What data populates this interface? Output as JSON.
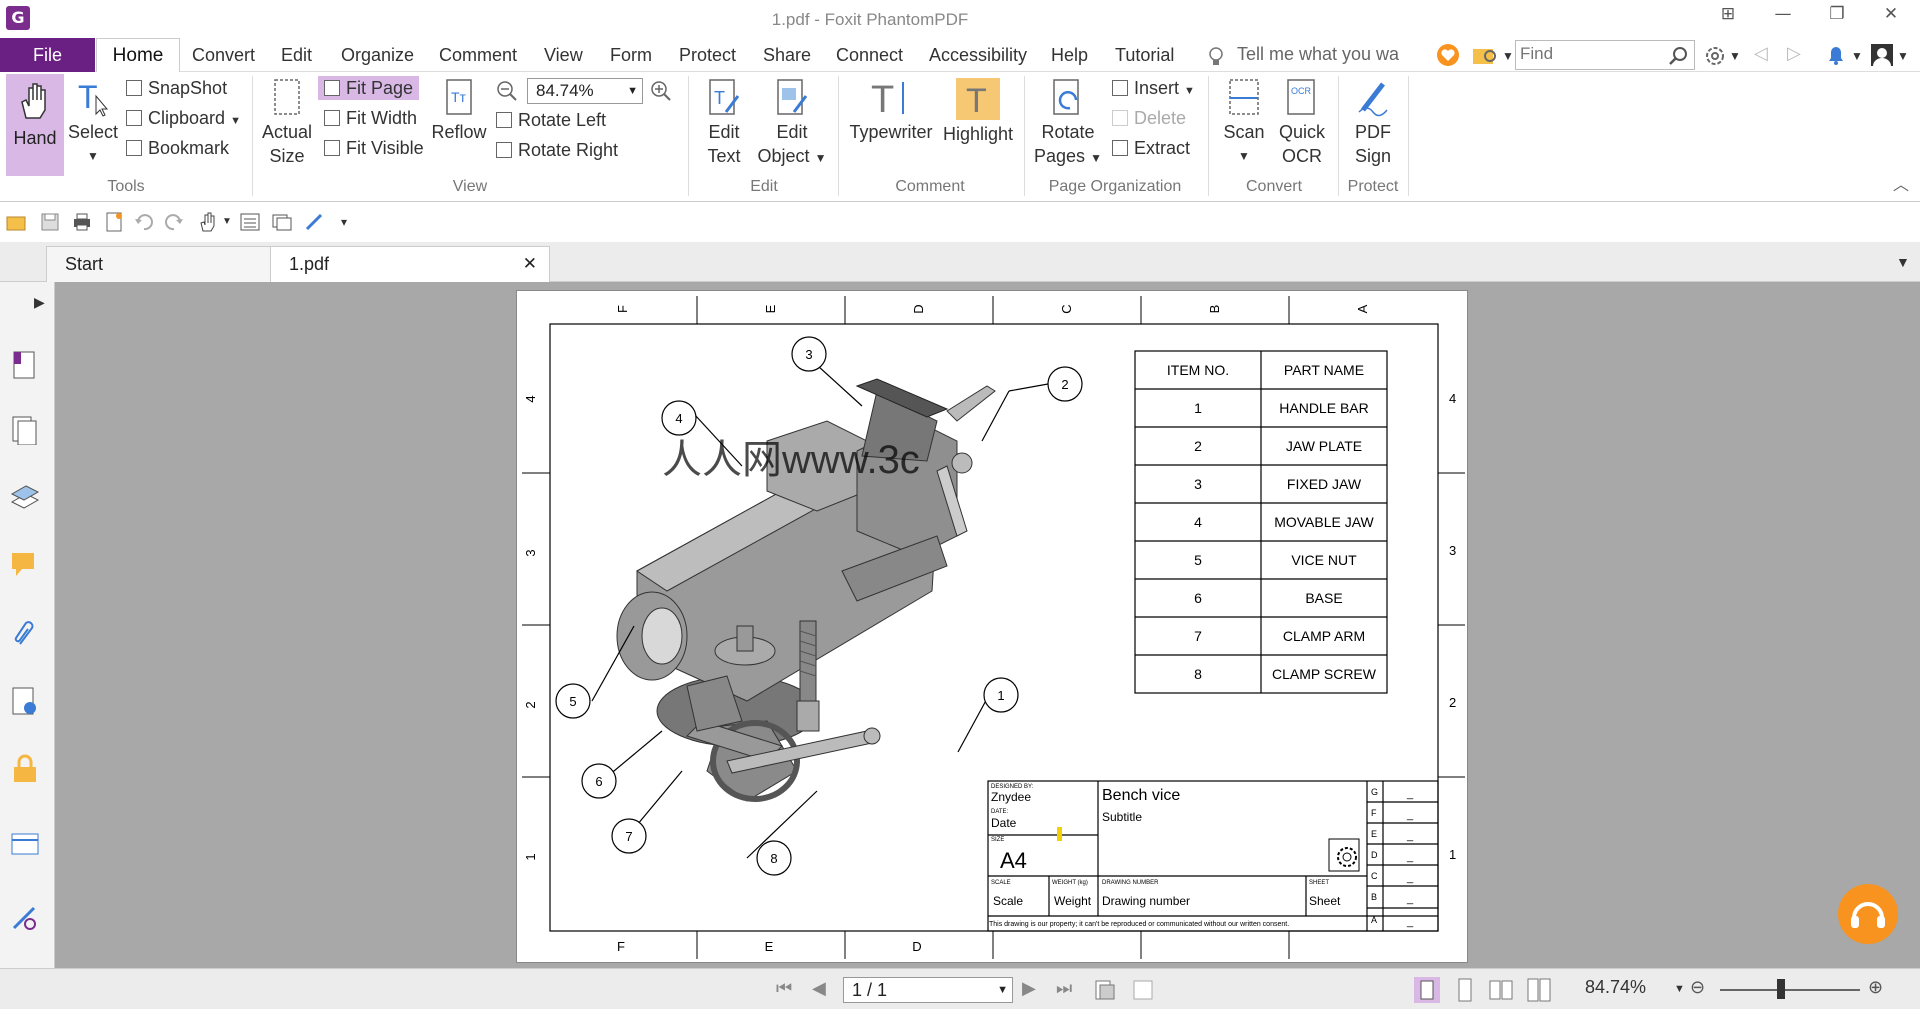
{
  "window": {
    "title": "1.pdf - Foxit PhantomPDF",
    "logo": "G"
  },
  "menu": {
    "file": "File",
    "items": [
      "Home",
      "Convert",
      "Edit",
      "Organize",
      "Comment",
      "View",
      "Form",
      "Protect",
      "Share",
      "Connect",
      "Accessibility",
      "Help",
      "Tutorial"
    ],
    "tell_me": "Tell me what you wa",
    "find_placeholder": "Find"
  },
  "ribbon": {
    "tools": {
      "label": "Tools",
      "hand": "Hand",
      "select": "Select",
      "snapshot": "SnapShot",
      "clipboard": "Clipboard",
      "bookmark": "Bookmark"
    },
    "view": {
      "label": "View",
      "actual1": "Actual",
      "actual2": "Size",
      "fit_page": "Fit Page",
      "fit_width": "Fit Width",
      "fit_visible": "Fit Visible",
      "reflow": "Reflow",
      "zoom": "84.74%",
      "rotate_left": "Rotate Left",
      "rotate_right": "Rotate Right"
    },
    "edit": {
      "label": "Edit",
      "edit_text1": "Edit",
      "edit_text2": "Text",
      "edit_object1": "Edit",
      "edit_object2": "Object"
    },
    "comment": {
      "label": "Comment",
      "typewriter": "Typewriter",
      "highlight": "Highlight"
    },
    "page_org": {
      "label": "Page Organization",
      "rotate1": "Rotate",
      "rotate2": "Pages",
      "insert": "Insert",
      "delete": "Delete",
      "extract": "Extract"
    },
    "convert": {
      "label": "Convert",
      "scan": "Scan",
      "quick1": "Quick",
      "quick2": "OCR",
      "ocr_badge": "OCR"
    },
    "protect": {
      "label": "Protect",
      "sign1": "PDF",
      "sign2": "Sign"
    }
  },
  "tabs": {
    "start": "Start",
    "doc": "1.pdf",
    "close": "✕"
  },
  "drawing": {
    "col_labels": [
      "F",
      "E",
      "D",
      "C",
      "B",
      "A"
    ],
    "row_labels": [
      "4",
      "3",
      "2",
      "1"
    ],
    "bom_headers": [
      "ITEM NO.",
      "PART NAME"
    ],
    "bom_rows": [
      [
        "1",
        "HANDLE BAR"
      ],
      [
        "2",
        "JAW PLATE"
      ],
      [
        "3",
        "FIXED JAW"
      ],
      [
        "4",
        "MOVABLE JAW"
      ],
      [
        "5",
        "VICE NUT"
      ],
      [
        "6",
        "BASE"
      ],
      [
        "7",
        "CLAMP ARM"
      ],
      [
        "8",
        "CLAMP SCREW"
      ]
    ],
    "balloons": [
      "1",
      "2",
      "3",
      "4",
      "5",
      "6",
      "7",
      "8"
    ],
    "watermark": "人人网www.3c",
    "title_block": {
      "designed_by_label": "DESIGNED BY:",
      "designed_by": "Znydee",
      "date_label": "DATE:",
      "date": "Date",
      "size_label": "SIZE",
      "size": "A4",
      "title": "Bench vice",
      "subtitle": "Subtitle",
      "scale_label": "SCALE",
      "scale": "Scale",
      "weight_label": "WEIGHT (kg)",
      "weight": "Weight",
      "drawing_number_label": "DRAWING NUMBER",
      "drawing_number": "Drawing number",
      "sheet_label": "SHEET",
      "sheet": "Sheet",
      "rev_letters": [
        "G",
        "F",
        "E",
        "D",
        "C",
        "B",
        "A"
      ],
      "rev_value": "_",
      "notice": "This drawing is our property; it can't be reproduced or communicated without our written consent."
    }
  },
  "status": {
    "page": "1 / 1",
    "zoom": "84.74%"
  },
  "colors": {
    "accent": "#6a1f83",
    "highlight": "#d9b8e6",
    "orange": "#f7931e"
  }
}
